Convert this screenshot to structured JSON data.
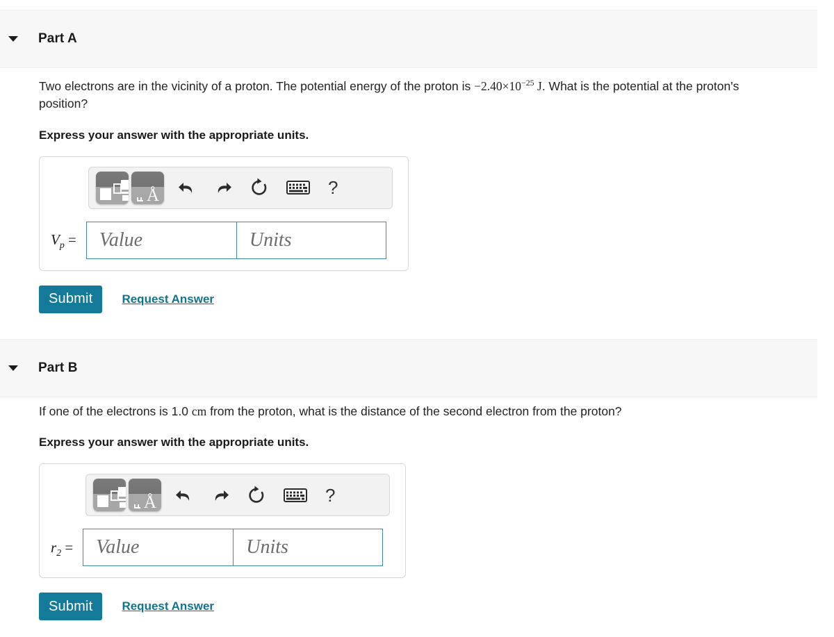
{
  "parts": [
    {
      "id": "part-a",
      "title": "Part A",
      "caret_icon": "caret-down-icon",
      "question": {
        "text_before": "Two electrons are in the vicinity of a proton. The potential energy of the proton is ",
        "math_value": "−2.40×10",
        "math_exponent": "−25",
        "math_unit": " J",
        "text_after": ". What is the potential at the proton's position?"
      },
      "instruction": "Express your answer with the appropriate units.",
      "toolbar": {
        "template_icon": "math-template-icon",
        "units_icon": "units-angstrom-icon",
        "units_glyph": "Å",
        "undo_icon": "undo-icon",
        "redo_icon": "redo-icon",
        "reset_icon": "reset-icon",
        "keyboard_icon": "keyboard-icon",
        "help_icon": "help-question-icon",
        "help_glyph": "?"
      },
      "input": {
        "variable": "V",
        "subscript": "p",
        "equals": " =",
        "value_placeholder": "Value",
        "units_placeholder": "Units",
        "value": "",
        "units": ""
      },
      "submit_label": "Submit",
      "request_label": "Request Answer"
    },
    {
      "id": "part-b",
      "title": "Part B",
      "caret_icon": "caret-down-icon",
      "question": {
        "text_before": "If one of the electrons is 1.0 ",
        "math_value": "cm",
        "math_exponent": "",
        "math_unit": "",
        "text_after": " from the proton, what is the distance of the second electron from the proton?"
      },
      "instruction": "Express your answer with the appropriate units.",
      "toolbar": {
        "template_icon": "math-template-icon",
        "units_icon": "units-angstrom-icon",
        "units_glyph": "Å",
        "undo_icon": "undo-icon",
        "redo_icon": "redo-icon",
        "reset_icon": "reset-icon",
        "keyboard_icon": "keyboard-icon",
        "help_icon": "help-question-icon",
        "help_glyph": "?"
      },
      "input": {
        "variable": "r",
        "subscript": "2",
        "equals": " =",
        "value_placeholder": "Value",
        "units_placeholder": "Units",
        "value": "",
        "units": ""
      },
      "submit_label": "Submit",
      "request_label": "Request Answer"
    }
  ],
  "colors": {
    "accent": "#137a9a",
    "link": "#0f7490",
    "header_bg": "#f7f7f7",
    "field_border": "#3f8ba3",
    "text": "#222222"
  }
}
